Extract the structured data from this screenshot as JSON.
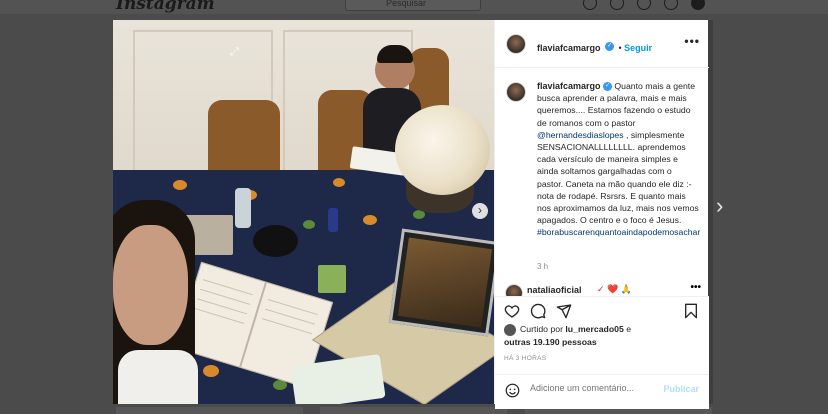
{
  "nav": {
    "brand": "Instagram",
    "search_placeholder": "Pesquisar"
  },
  "post": {
    "header": {
      "username": "flaviafcamargo",
      "follow_label": "Seguir",
      "more_label": "•••"
    },
    "caption": {
      "username": "flaviafcamargo",
      "text_1": "Quanto mais a gente busca aprender a palavra, mais e mais queremos.... Estamos fazendo o estudo de romanos com o pastor ",
      "mention": "@hernandesdiaslopes",
      "text_2": " , simplesmente SENSACIONALLLLLLLL. aprendemos cada versículo de maneira simples e ainda soltamos gargalhadas com o pastor. Caneta na mão quando ele diz :- nota de rodapé. Rsrsrs. E quanto mais nos aproximamos da luz, mais nos vemos apagados. O centro e o foco é Jesus. ",
      "hashtag": "#borabuscarenquantoaindapodemosachar"
    },
    "caption_time": "3 h",
    "next_comment_user": "nataliaoficial",
    "next_comment_more": "•••",
    "likes": {
      "prefix": "Curtido por ",
      "user": "lu_mercado05",
      "mid": " e",
      "others": "outras 19.190 pessoas"
    },
    "ago": "HÁ 3 HORAS",
    "add_comment_placeholder": "Adicione um comentário...",
    "publish_label": "Publicar"
  },
  "icons": {
    "heart": "heart-icon",
    "comment": "comment-icon",
    "share": "share-icon",
    "save": "bookmark-icon",
    "emoji": "emoji-icon",
    "next": "chevron-right-icon"
  },
  "colors": {
    "link": "#00376b",
    "accent": "#0095f6",
    "overlay": "#4b4b4b"
  }
}
